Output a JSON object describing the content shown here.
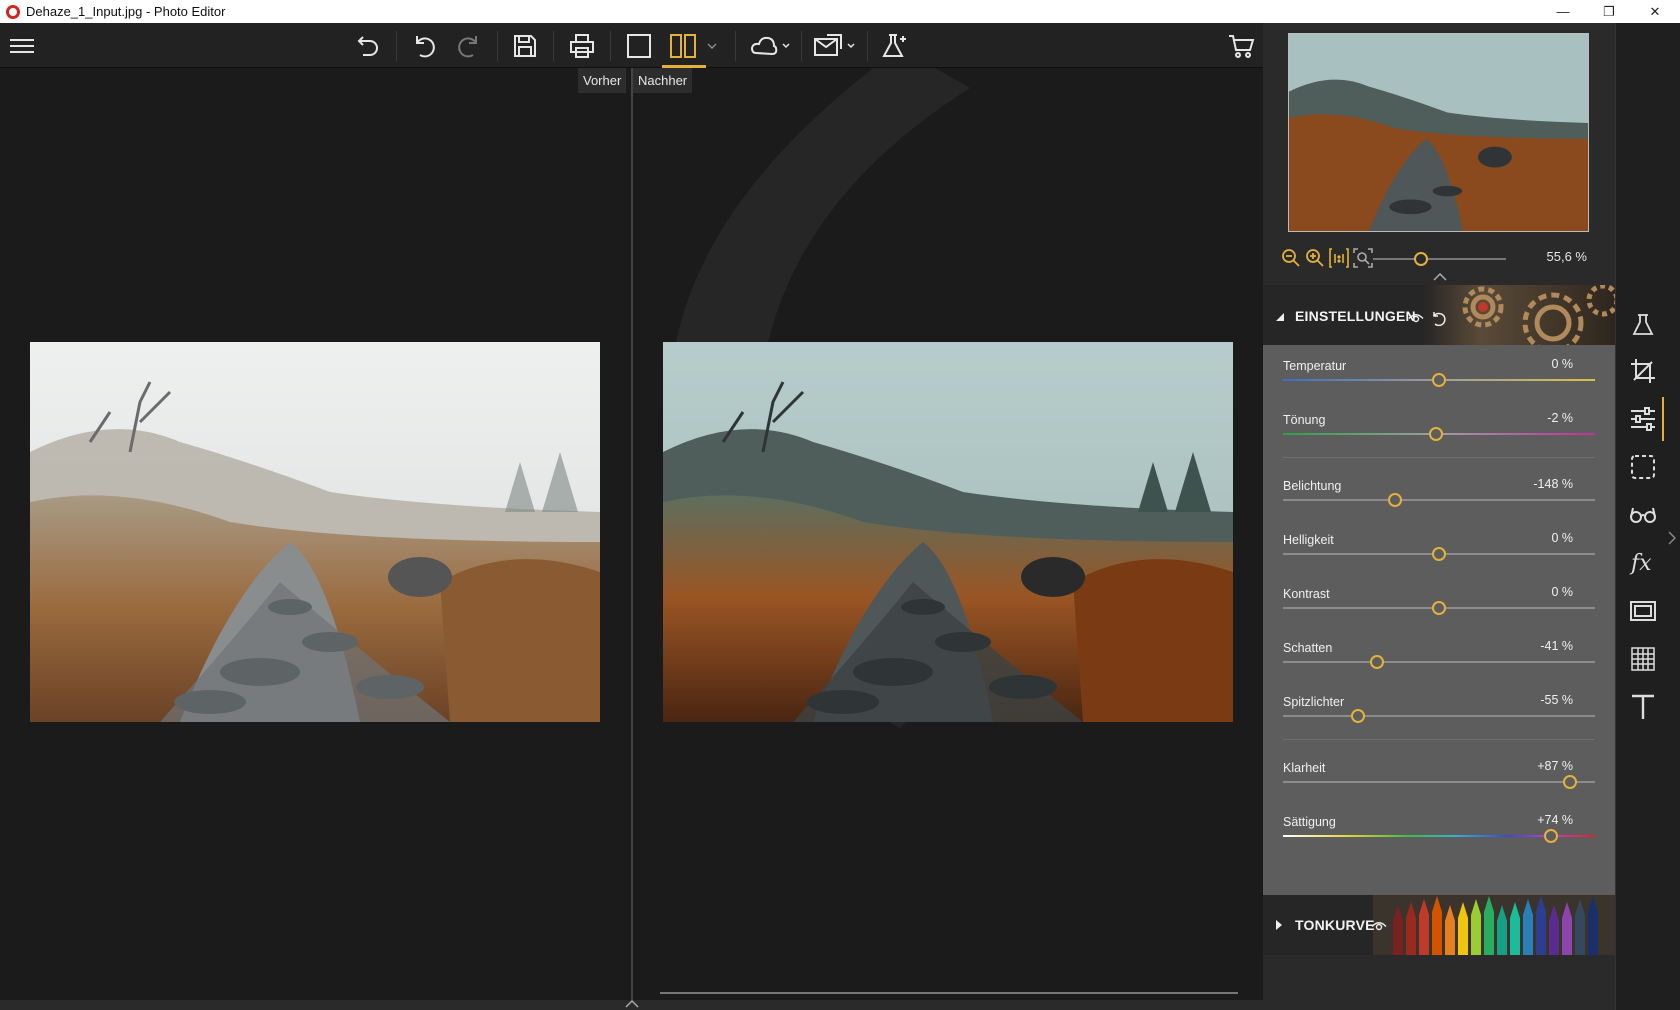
{
  "window": {
    "title": "Dehaze_1_Input.jpg - Photo Editor",
    "minimize": "—",
    "restore": "❐",
    "close": "✕"
  },
  "toolbar": {
    "tooltip_before": "Vorher",
    "tooltip_after": "Nachher",
    "accent_color": "#e3b23c"
  },
  "navigator": {
    "zoom_value": "55,6 %"
  },
  "adjustments": {
    "section_title": "EINSTELLUNGEN",
    "sliders": [
      {
        "label": "Temperatur",
        "value": "0 %",
        "position": 0.5
      },
      {
        "label": "Tönung",
        "value": "-2 %",
        "position": 0.49
      },
      {
        "label": "Belichtung",
        "value": "-148 %",
        "position": 0.36
      },
      {
        "label": "Helligkeit",
        "value": "0 %",
        "position": 0.5
      },
      {
        "label": "Kontrast",
        "value": "0 %",
        "position": 0.5
      },
      {
        "label": "Schatten",
        "value": "-41 %",
        "position": 0.3
      },
      {
        "label": "Spitzlichter",
        "value": "-55 %",
        "position": 0.24
      },
      {
        "label": "Klarheit",
        "value": "+87 %",
        "position": 0.92
      },
      {
        "label": "Sättigung",
        "value": "+74 %",
        "position": 0.86
      }
    ]
  },
  "tone_curve": {
    "section_title": "TONKURVE"
  },
  "side_tools": [
    "flask-icon",
    "crop-icon",
    "sliders-icon",
    "selection-icon",
    "glasses-icon",
    "fx-icon",
    "frame-icon",
    "grid-icon",
    "text-icon"
  ]
}
